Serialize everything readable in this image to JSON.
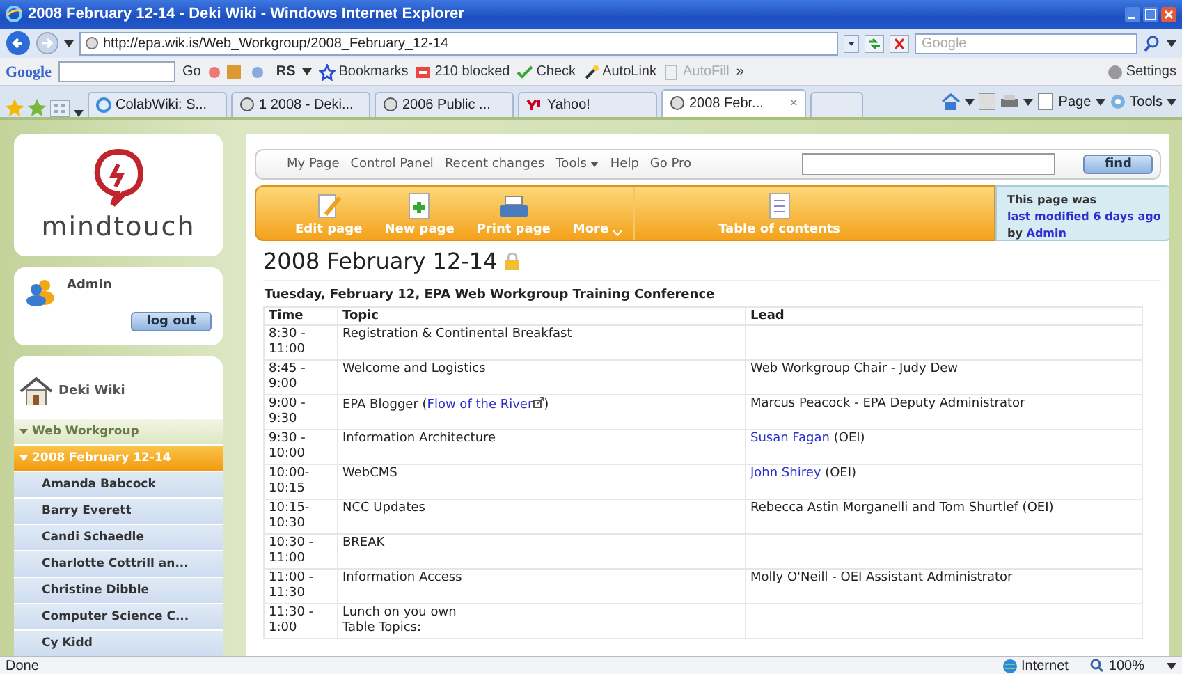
{
  "window": {
    "title": "2008 February 12-14 - Deki Wiki - Windows Internet Explorer"
  },
  "address_bar": {
    "url": "http://epa.wik.is/Web_Workgroup/2008_February_12-14"
  },
  "search": {
    "placeholder": "Google"
  },
  "google_toolbar": {
    "logo": "Google",
    "go": "Go",
    "rs": "RS",
    "more": "»",
    "items": [
      {
        "label": "Bookmarks",
        "kind": "bookmarks",
        "disabled": false
      },
      {
        "label": "210 blocked",
        "kind": "blocked",
        "disabled": false
      },
      {
        "label": "Check",
        "kind": "check",
        "disabled": false
      },
      {
        "label": "AutoLink",
        "kind": "autolink",
        "disabled": false
      },
      {
        "label": "AutoFill",
        "kind": "autofill",
        "disabled": true
      }
    ],
    "settings": "Settings"
  },
  "tabs": [
    {
      "label": "ColabWiki: S...",
      "kind": "ie",
      "selected": false
    },
    {
      "label": "1 2008 - Deki...",
      "kind": "deki",
      "selected": false
    },
    {
      "label": "2006 Public ...",
      "kind": "deki",
      "selected": false
    },
    {
      "label": "Yahoo!",
      "kind": "yahoo",
      "selected": false
    },
    {
      "label": "2008 Febr...",
      "kind": "deki",
      "selected": true
    }
  ],
  "tab_close": "×",
  "command_bar": [
    "Page",
    "Tools"
  ],
  "sidebar": {
    "logo": "mindtouch",
    "user": "Admin",
    "logout": "log out",
    "home": "Deki Wiki",
    "nav": [
      {
        "label": "Web Workgroup",
        "selected": false,
        "children": [
          {
            "label": "2008 February 12-14",
            "selected": true,
            "children": [
              {
                "label": "Amanda Babcock",
                "selected": false
              },
              {
                "label": "Barry Everett",
                "selected": false
              },
              {
                "label": "Candi Schaedle",
                "selected": false
              },
              {
                "label": "Charlotte Cottrill an...",
                "selected": false
              },
              {
                "label": "Christine Dibble",
                "selected": false
              },
              {
                "label": "Computer Science C...",
                "selected": false
              },
              {
                "label": "Cy Kidd",
                "selected": false
              }
            ]
          }
        ]
      }
    ]
  },
  "top_nav": {
    "links": [
      "My Page",
      "Control Panel",
      "Recent changes",
      "Tools",
      "Help",
      "Go Pro"
    ],
    "find": "find"
  },
  "page_actions": [
    {
      "label": "Edit page",
      "kind": "edit"
    },
    {
      "label": "New page",
      "kind": "new"
    },
    {
      "label": "Print page",
      "kind": "print"
    },
    {
      "label": "More",
      "kind": "more"
    },
    {
      "label": "Table of contents",
      "kind": "toc"
    }
  ],
  "page_info": {
    "prefix": "This page was",
    "link": "last modified 6 days ago",
    "middle": "by",
    "author": "Admin"
  },
  "page": {
    "title": "2008 February 12-14",
    "subtitle": "Tuesday, February 12, EPA Web Workgroup Training Conference"
  },
  "table": {
    "columns": [
      "Time",
      "Topic",
      "Lead"
    ],
    "rows": [
      [
        [
          [
            {
              "kind": "text",
              "text": "8:30 -"
            }
          ],
          [
            {
              "kind": "text",
              "text": "11:00"
            }
          ]
        ],
        [
          [
            {
              "kind": "text",
              "text": "Registration & Continental Breakfast"
            }
          ]
        ],
        []
      ],
      [
        [
          [
            {
              "kind": "text",
              "text": "8:45 -"
            }
          ],
          [
            {
              "kind": "text",
              "text": "9:00"
            }
          ]
        ],
        [
          [
            {
              "kind": "text",
              "text": "Welcome and Logistics"
            }
          ]
        ],
        [
          [
            {
              "kind": "text",
              "text": "Web Workgroup Chair - Judy Dew"
            }
          ]
        ]
      ],
      [
        [
          [
            {
              "kind": "text",
              "text": "9:00 -"
            }
          ],
          [
            {
              "kind": "text",
              "text": "9:30"
            }
          ]
        ],
        [
          [
            {
              "kind": "text",
              "text": "EPA Blogger ("
            },
            {
              "kind": "external_link",
              "text": "Flow of the River"
            },
            {
              "kind": "text",
              "text": ")"
            }
          ]
        ],
        [
          [
            {
              "kind": "text",
              "text": "Marcus Peacock - EPA Deputy Administrator"
            }
          ]
        ]
      ],
      [
        [
          [
            {
              "kind": "text",
              "text": "9:30 -"
            }
          ],
          [
            {
              "kind": "text",
              "text": "10:00"
            }
          ]
        ],
        [
          [
            {
              "kind": "text",
              "text": "Information Architecture"
            }
          ]
        ],
        [
          [
            {
              "kind": "link",
              "text": "Susan Fagan"
            },
            {
              "kind": "text",
              "text": " (OEI)"
            }
          ]
        ]
      ],
      [
        [
          [
            {
              "kind": "text",
              "text": "10:00-"
            }
          ],
          [
            {
              "kind": "text",
              "text": "10:15"
            }
          ]
        ],
        [
          [
            {
              "kind": "text",
              "text": "WebCMS"
            }
          ]
        ],
        [
          [
            {
              "kind": "link",
              "text": "John Shirey"
            },
            {
              "kind": "text",
              "text": " (OEI)"
            }
          ]
        ]
      ],
      [
        [
          [
            {
              "kind": "text",
              "text": "10:15-"
            }
          ],
          [
            {
              "kind": "text",
              "text": "10:30"
            }
          ]
        ],
        [
          [
            {
              "kind": "text",
              "text": "NCC Updates"
            }
          ]
        ],
        [
          [
            {
              "kind": "text",
              "text": "Rebecca Astin Morganelli and Tom Shurtlef (OEI)"
            }
          ]
        ]
      ],
      [
        [
          [
            {
              "kind": "text",
              "text": "10:30 -"
            }
          ],
          [
            {
              "kind": "text",
              "text": "11:00"
            }
          ]
        ],
        [
          [
            {
              "kind": "text",
              "text": "BREAK"
            }
          ]
        ],
        []
      ],
      [
        [
          [
            {
              "kind": "text",
              "text": "11:00 -"
            }
          ],
          [
            {
              "kind": "text",
              "text": "11:30"
            }
          ]
        ],
        [
          [
            {
              "kind": "text",
              "text": "Information Access"
            }
          ]
        ],
        [
          [
            {
              "kind": "text",
              "text": "Molly O'Neill - OEI Assistant Administrator"
            }
          ]
        ]
      ],
      [
        [
          [
            {
              "kind": "text",
              "text": "11:30 -"
            }
          ],
          [
            {
              "kind": "text",
              "text": "1:00"
            }
          ]
        ],
        [
          [
            {
              "kind": "text",
              "text": "Lunch on you own"
            }
          ],
          [
            {
              "kind": "text",
              "text": "Table Topics:"
            }
          ]
        ],
        []
      ]
    ]
  },
  "status_bar": {
    "text": "Done",
    "zone": "Internet",
    "zoom": "100%"
  }
}
